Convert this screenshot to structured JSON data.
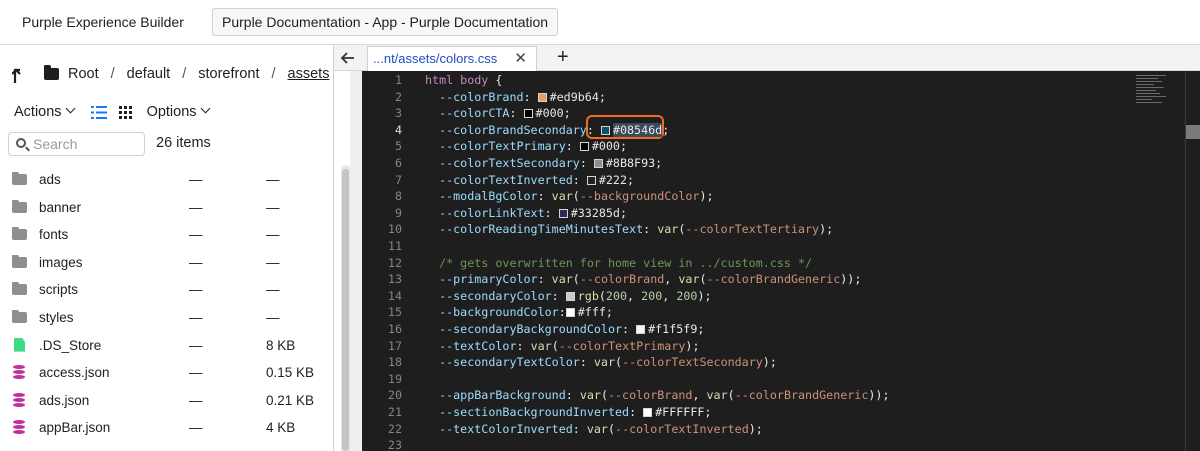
{
  "top_tabs": [
    {
      "label": "Purple Experience Builder"
    },
    {
      "label": "Purple Documentation - App - Purple Documentation"
    }
  ],
  "breadcrumb": {
    "items": [
      "Root",
      "default",
      "storefront",
      "assets"
    ]
  },
  "toolbar": {
    "actions_label": "Actions",
    "options_label": "Options"
  },
  "search": {
    "placeholder": "Search"
  },
  "item_count": "26 items",
  "files": [
    {
      "name": "ads",
      "type": "folder",
      "modified": "—",
      "size": "—"
    },
    {
      "name": "banner",
      "type": "folder",
      "modified": "—",
      "size": "—"
    },
    {
      "name": "fonts",
      "type": "folder",
      "modified": "—",
      "size": "—"
    },
    {
      "name": "images",
      "type": "folder",
      "modified": "—",
      "size": "—"
    },
    {
      "name": "scripts",
      "type": "folder",
      "modified": "—",
      "size": "—"
    },
    {
      "name": "styles",
      "type": "folder",
      "modified": "—",
      "size": "—"
    },
    {
      "name": ".DS_Store",
      "type": "file",
      "modified": "—",
      "size": "8 KB"
    },
    {
      "name": "access.json",
      "type": "json",
      "modified": "—",
      "size": "0.15 KB"
    },
    {
      "name": "ads.json",
      "type": "json",
      "modified": "—",
      "size": "0.21 KB"
    },
    {
      "name": "appBar.json",
      "type": "json",
      "modified": "—",
      "size": "4 KB"
    }
  ],
  "editor": {
    "tab_label": "...nt/assets/colors.css",
    "tab_close": "✕",
    "add_tab": "+",
    "current_line": 4,
    "lines": [
      [
        {
          "c": "sel",
          "t": "html body "
        },
        {
          "c": "val",
          "t": "{"
        }
      ],
      [
        {
          "c": "prop",
          "t": "  --colorBrand"
        },
        {
          "c": "val",
          "t": ": "
        },
        {
          "sw": "#ed9b64"
        },
        {
          "c": "val",
          "t": "#ed9b64;"
        }
      ],
      [
        {
          "c": "prop",
          "t": "  --colorCTA"
        },
        {
          "c": "val",
          "t": ": "
        },
        {
          "sw": "#000000"
        },
        {
          "c": "val",
          "t": "#000;"
        }
      ],
      [
        {
          "c": "prop",
          "t": "  --colorBrandSecondary"
        },
        {
          "c": "val",
          "t": ": "
        },
        {
          "sw": "#08546d",
          "hl": true
        },
        {
          "c": "val hl",
          "t": "#08546d"
        },
        {
          "c": "val",
          "t": ";"
        }
      ],
      [
        {
          "c": "prop",
          "t": "  --colorTextPrimary"
        },
        {
          "c": "val",
          "t": ": "
        },
        {
          "sw": "#000000"
        },
        {
          "c": "val",
          "t": "#000;"
        }
      ],
      [
        {
          "c": "prop",
          "t": "  --colorTextSecondary"
        },
        {
          "c": "val",
          "t": ": "
        },
        {
          "sw": "#8B8F93"
        },
        {
          "c": "val",
          "t": "#8B8F93;"
        }
      ],
      [
        {
          "c": "prop",
          "t": "  --colorTextInverted"
        },
        {
          "c": "val",
          "t": ": "
        },
        {
          "sw": "#222222"
        },
        {
          "c": "val",
          "t": "#222;"
        }
      ],
      [
        {
          "c": "prop",
          "t": "  --modalBgColor"
        },
        {
          "c": "val",
          "t": ": "
        },
        {
          "c": "fn",
          "t": "var"
        },
        {
          "c": "val",
          "t": "("
        },
        {
          "c": "var",
          "t": "--backgroundColor"
        },
        {
          "c": "val",
          "t": ");"
        }
      ],
      [
        {
          "c": "prop",
          "t": "  --colorLinkText"
        },
        {
          "c": "val",
          "t": ": "
        },
        {
          "sw": "#33285d"
        },
        {
          "c": "val",
          "t": "#33285d;"
        }
      ],
      [
        {
          "c": "prop",
          "t": "  --colorReadingTimeMinutesText"
        },
        {
          "c": "val",
          "t": ": "
        },
        {
          "c": "fn",
          "t": "var"
        },
        {
          "c": "val",
          "t": "("
        },
        {
          "c": "var",
          "t": "--colorTextTertiary"
        },
        {
          "c": "val",
          "t": ");"
        }
      ],
      [],
      [
        {
          "c": "cmt",
          "t": "  /* gets overwritten for home view in ../custom.css */"
        }
      ],
      [
        {
          "c": "prop",
          "t": "  --primaryColor"
        },
        {
          "c": "val",
          "t": ": "
        },
        {
          "c": "fn",
          "t": "var"
        },
        {
          "c": "val",
          "t": "("
        },
        {
          "c": "var",
          "t": "--colorBrand"
        },
        {
          "c": "val",
          "t": ", "
        },
        {
          "c": "fn",
          "t": "var"
        },
        {
          "c": "val",
          "t": "("
        },
        {
          "c": "var",
          "t": "--colorBrandGeneric"
        },
        {
          "c": "val",
          "t": "));"
        }
      ],
      [
        {
          "c": "prop",
          "t": "  --secondaryColor"
        },
        {
          "c": "val",
          "t": ": "
        },
        {
          "sw": "#c8c8c8"
        },
        {
          "c": "fn",
          "t": "rgb"
        },
        {
          "c": "val",
          "t": "("
        },
        {
          "c": "num",
          "t": "200"
        },
        {
          "c": "val",
          "t": ", "
        },
        {
          "c": "num",
          "t": "200"
        },
        {
          "c": "val",
          "t": ", "
        },
        {
          "c": "num",
          "t": "200"
        },
        {
          "c": "val",
          "t": ");"
        }
      ],
      [
        {
          "c": "prop",
          "t": "  --backgroundColor"
        },
        {
          "c": "val",
          "t": ":"
        },
        {
          "sw": "#ffffff"
        },
        {
          "c": "val",
          "t": "#fff;"
        }
      ],
      [
        {
          "c": "prop",
          "t": "  --secondaryBackgroundColor"
        },
        {
          "c": "val",
          "t": ": "
        },
        {
          "sw": "#f1f5f9"
        },
        {
          "c": "val",
          "t": "#f1f5f9;"
        }
      ],
      [
        {
          "c": "prop",
          "t": "  --textColor"
        },
        {
          "c": "val",
          "t": ": "
        },
        {
          "c": "fn",
          "t": "var"
        },
        {
          "c": "val",
          "t": "("
        },
        {
          "c": "var",
          "t": "--colorTextPrimary"
        },
        {
          "c": "val",
          "t": ");"
        }
      ],
      [
        {
          "c": "prop",
          "t": "  --secondaryTextColor"
        },
        {
          "c": "val",
          "t": ": "
        },
        {
          "c": "fn",
          "t": "var"
        },
        {
          "c": "val",
          "t": "("
        },
        {
          "c": "var",
          "t": "--colorTextSecondary"
        },
        {
          "c": "val",
          "t": ");"
        }
      ],
      [],
      [
        {
          "c": "prop",
          "t": "  --appBarBackground"
        },
        {
          "c": "val",
          "t": ": "
        },
        {
          "c": "fn",
          "t": "var"
        },
        {
          "c": "val",
          "t": "("
        },
        {
          "c": "var",
          "t": "--colorBrand"
        },
        {
          "c": "val",
          "t": ", "
        },
        {
          "c": "fn",
          "t": "var"
        },
        {
          "c": "val",
          "t": "("
        },
        {
          "c": "var",
          "t": "--colorBrandGeneric"
        },
        {
          "c": "val",
          "t": "));"
        }
      ],
      [
        {
          "c": "prop",
          "t": "  --sectionBackgroundInverted"
        },
        {
          "c": "val",
          "t": ": "
        },
        {
          "sw": "#FFFFFF"
        },
        {
          "c": "val",
          "t": "#FFFFFF;"
        }
      ],
      [
        {
          "c": "prop",
          "t": "  --textColorInverted"
        },
        {
          "c": "val",
          "t": ": "
        },
        {
          "c": "fn",
          "t": "var"
        },
        {
          "c": "val",
          "t": "("
        },
        {
          "c": "var",
          "t": "--colorTextInverted"
        },
        {
          "c": "val",
          "t": ");"
        }
      ],
      []
    ]
  }
}
